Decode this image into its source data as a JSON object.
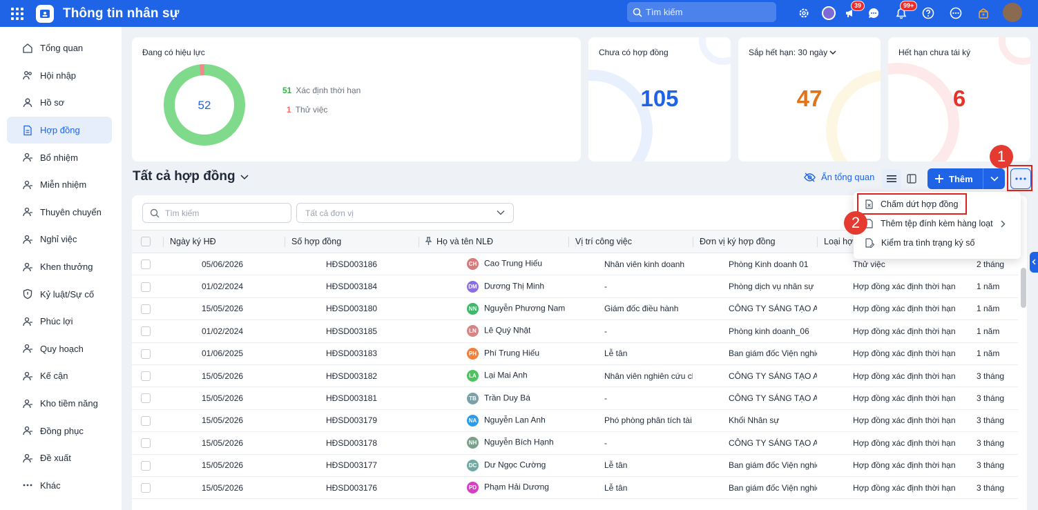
{
  "app": {
    "title": "Thông tin nhân sự",
    "search_placeholder": "Tìm kiếm",
    "badges": {
      "megaphone": "39",
      "bell": "99+"
    }
  },
  "sidebar": {
    "items": [
      {
        "label": "Tổng quan",
        "icon": "home-icon"
      },
      {
        "label": "Hội nhập",
        "icon": "users-icon"
      },
      {
        "label": "Hồ sơ",
        "icon": "user-icon"
      },
      {
        "label": "Hợp đồng",
        "icon": "contract-icon",
        "active": true
      },
      {
        "label": "Bổ nhiệm",
        "icon": "user-plus-icon"
      },
      {
        "label": "Miễn nhiệm",
        "icon": "user-minus-icon"
      },
      {
        "label": "Thuyên chuyển",
        "icon": "transfer-icon"
      },
      {
        "label": "Nghỉ việc",
        "icon": "user-leave-icon"
      },
      {
        "label": "Khen thưởng",
        "icon": "award-icon"
      },
      {
        "label": "Kỷ luật/Sự cố",
        "icon": "shield-icon"
      },
      {
        "label": "Phúc lợi",
        "icon": "benefit-icon"
      },
      {
        "label": "Quy hoạch",
        "icon": "planning-icon"
      },
      {
        "label": "Kế cận",
        "icon": "org-chart-icon"
      },
      {
        "label": "Kho tiềm năng",
        "icon": "talent-pool-icon"
      },
      {
        "label": "Đồng phục",
        "icon": "shirt-icon"
      },
      {
        "label": "Đề xuất",
        "icon": "proposal-icon"
      },
      {
        "label": "Khác",
        "icon": "more-horizontal-icon"
      }
    ]
  },
  "summary": {
    "effective": {
      "label": "Đang có hiệu lực",
      "total": "52",
      "fixed_term_fraction": 0.98,
      "legend": [
        {
          "count": "51",
          "label": "Xác định thời hạn",
          "color": "#2fb344"
        },
        {
          "count": "1",
          "label": "Thử việc",
          "color": "#ef6a6a"
        }
      ]
    },
    "no_contract": {
      "label": "Chưa có hợp đồng",
      "value": "105",
      "color": "#1f63e6"
    },
    "expiring": {
      "label": "Sắp hết hạn:",
      "period": "30 ngày",
      "value": "47",
      "color": "#e0741b"
    },
    "expired": {
      "label": "Hết hạn chưa tái ký",
      "value": "6",
      "color": "#e5322b"
    }
  },
  "list": {
    "title": "Tất cả hợp đồng",
    "hide_overview": "Ẩn tổng quan",
    "add_label": "Thêm",
    "search_placeholder": "Tìm kiếm",
    "unit_placeholder": "Tất cả đơn vị"
  },
  "menu": {
    "items": [
      {
        "label": "Chấm dứt hợp đồng"
      },
      {
        "label": "Thêm tệp đính kèm hàng loạt"
      },
      {
        "label": "Kiểm tra tình trạng ký số"
      }
    ]
  },
  "steps": [
    "1",
    "2"
  ],
  "table": {
    "columns": [
      "Ngày ký HĐ",
      "Số hợp đồng",
      "Họ và tên NLĐ",
      "Vị trí công việc",
      "Đơn vị ký hợp đồng",
      "Loại hợp",
      ""
    ],
    "rows": [
      {
        "date": "05/06/2026",
        "no": "HĐSD003186",
        "initials": "CH",
        "color": "#d97a7a",
        "name": "Cao Trung Hiếu",
        "pos": "Nhân viên kinh doanh",
        "unit": "Phòng Kinh doanh 01",
        "type": "Thử việc",
        "dur": "2 tháng"
      },
      {
        "date": "01/02/2024",
        "no": "HĐSD003184",
        "initials": "DM",
        "color": "#8b6fe0",
        "name": "Dương Thị Minh",
        "pos": "-",
        "unit": "Phòng dịch vụ nhân sự",
        "type": "Hợp đồng xác định thời hạn",
        "dur": "1 năm"
      },
      {
        "date": "15/05/2026",
        "no": "HĐSD003180",
        "initials": "NN",
        "color": "#3fb86b",
        "name": "Nguyễn Phương Nam",
        "pos": "Giám đốc điều hành",
        "unit": "CÔNG TY SÁNG TẠO ANH ...",
        "type": "Hợp đồng xác định thời hạn",
        "dur": "1 năm"
      },
      {
        "date": "01/02/2024",
        "no": "HĐSD003185",
        "initials": "LN",
        "color": "#d98484",
        "name": "Lê Quý Nhật",
        "pos": "-",
        "unit": "Phòng kinh doanh_06",
        "type": "Hợp đồng xác định thời hạn",
        "dur": "1 năm"
      },
      {
        "date": "01/06/2025",
        "no": "HĐSD003183",
        "initials": "PH",
        "color": "#f0803c",
        "name": "Phí Trung Hiếu",
        "pos": "Lễ tân",
        "unit": "Ban giám đốc Viện nghiên ...",
        "type": "Hợp đồng xác định thời hạn",
        "dur": "1 năm"
      },
      {
        "date": "15/05/2026",
        "no": "HĐSD003182",
        "initials": "LA",
        "color": "#4cc45e",
        "name": "Lại Mai Anh",
        "pos": "Nhân viên nghiên cứu chiến l",
        "unit": "CÔNG TY SÁNG TẠO ANH ...",
        "type": "Hợp đồng xác định thời hạn",
        "dur": "3 tháng"
      },
      {
        "date": "15/05/2026",
        "no": "HĐSD003181",
        "initials": "TB",
        "color": "#7aa0a8",
        "name": "Trần Duy Bá",
        "pos": "-",
        "unit": "CÔNG TY SÁNG TẠO ANH ...",
        "type": "Hợp đồng xác định thời hạn",
        "dur": "3 tháng"
      },
      {
        "date": "15/05/2026",
        "no": "HĐSD003179",
        "initials": "NA",
        "color": "#2f9be6",
        "name": "Nguyễn Lan Anh",
        "pos": "Phó phòng phân tích tài chính",
        "unit": "Khối Nhân sự",
        "type": "Hợp đồng xác định thời hạn",
        "dur": "3 tháng"
      },
      {
        "date": "15/05/2026",
        "no": "HĐSD003178",
        "initials": "NH",
        "color": "#7aa08a",
        "name": "Nguyễn Bích Hạnh",
        "pos": "-",
        "unit": "CÔNG TY SÁNG TẠO ANH ...",
        "type": "Hợp đồng xác định thời hạn",
        "dur": "3 tháng"
      },
      {
        "date": "15/05/2026",
        "no": "HĐSD003177",
        "initials": "DC",
        "color": "#72aaa3",
        "name": "Dư Ngọc Cường",
        "pos": "Lễ tân",
        "unit": "Ban giám đốc Viện nghiên ...",
        "type": "Hợp đồng xác định thời hạn",
        "dur": "3 tháng"
      },
      {
        "date": "15/05/2026",
        "no": "HĐSD003176",
        "initials": "PD",
        "color": "#d43fc4",
        "name": "Phạm Hải Dương",
        "pos": "Lễ tân",
        "unit": "Ban giám đốc Viện nghiên ...",
        "type": "Hợp đồng xác định thời hạn",
        "dur": "3 tháng"
      }
    ]
  }
}
